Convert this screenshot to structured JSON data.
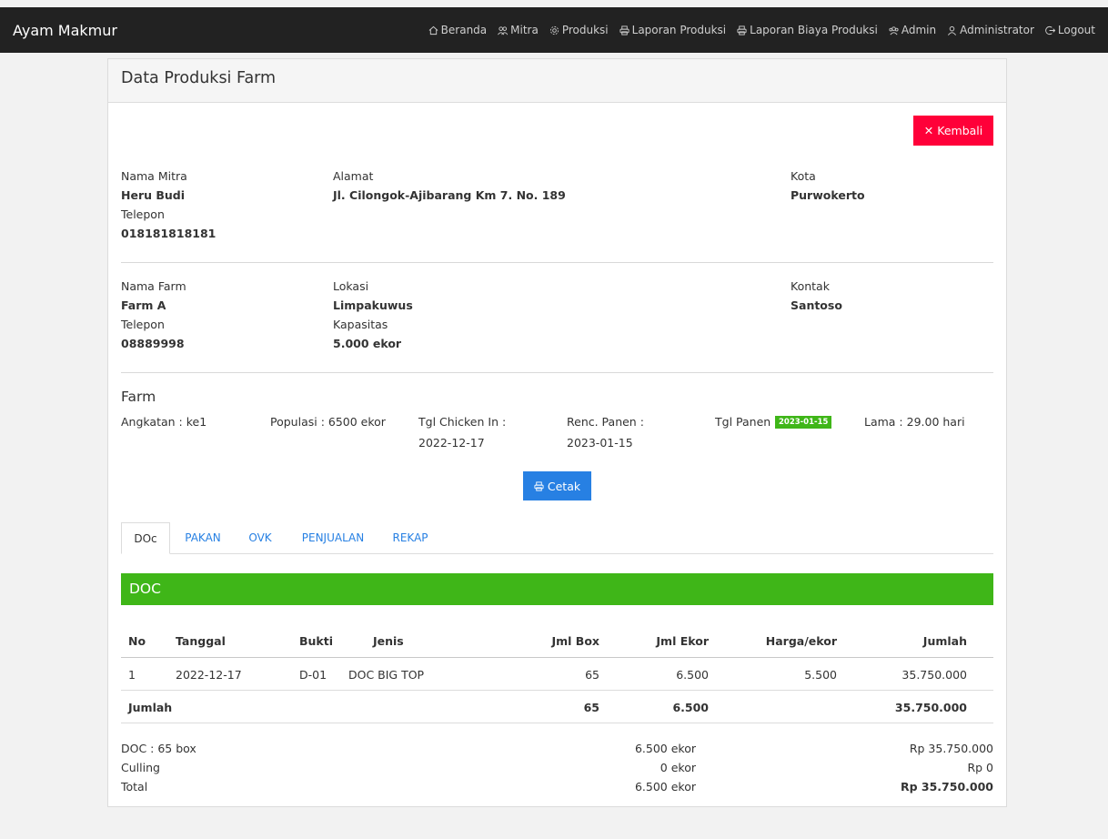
{
  "navbar": {
    "brand": "Ayam Makmur",
    "items": [
      {
        "label": "Beranda",
        "icon": "home-icon"
      },
      {
        "label": "Mitra",
        "icon": "users-icon"
      },
      {
        "label": "Produksi",
        "icon": "gear-icon"
      },
      {
        "label": "Laporan Produksi",
        "icon": "printer-icon"
      },
      {
        "label": "Laporan Biaya Produksi",
        "icon": "printer-icon"
      },
      {
        "label": "Admin",
        "icon": "group-icon"
      },
      {
        "label": "Administrator",
        "icon": "user-icon"
      },
      {
        "label": "Logout",
        "icon": "logout-icon"
      }
    ]
  },
  "panel": {
    "title": "Data Produksi Farm",
    "back_label": "Kembali",
    "print_label": "Cetak"
  },
  "mitra": {
    "nama_label": "Nama Mitra",
    "nama": "Heru Budi",
    "telepon_label": "Telepon",
    "telepon": "018181818181",
    "alamat_label": "Alamat",
    "alamat": "Jl. Cilongok-Ajibarang Km 7. No. 189",
    "kota_label": "Kota",
    "kota": "Purwokerto"
  },
  "farm_info": {
    "nama_label": "Nama Farm",
    "nama": "Farm A",
    "telepon_label": "Telepon",
    "telepon": "08889998",
    "lokasi_label": "Lokasi",
    "lokasi": "Limpakuwus",
    "kapasitas_label": "Kapasitas",
    "kapasitas": "5.000 ekor",
    "kontak_label": "Kontak",
    "kontak": "Santoso"
  },
  "farm": {
    "title": "Farm",
    "angkatan": "Angkatan : ke1",
    "populasi": "Populasi : 6500 ekor",
    "chicken_in_label": "Tgl Chicken In :",
    "chicken_in": "2022-12-17",
    "renc_panen_label": "Renc. Panen :",
    "renc_panen": "2023-01-15",
    "tgl_panen_label": "Tgl Panen :",
    "tgl_panen": "2023-01-15",
    "lama": "Lama : 29.00 hari"
  },
  "tabs": [
    "DOc",
    "PAKAN",
    "OVK",
    "PENJUALAN",
    "REKAP"
  ],
  "doc": {
    "heading": "DOC",
    "headers": {
      "no": "No",
      "tanggal": "Tanggal",
      "bukti": "Bukti",
      "jenis": "Jenis",
      "jml_box": "Jml Box",
      "jml_ekor": "Jml Ekor",
      "harga": "Harga/ekor",
      "jumlah": "Jumlah"
    },
    "rows": [
      {
        "no": "1",
        "tanggal": "2022-12-17",
        "bukti": "D-01",
        "jenis": "DOC BIG TOP",
        "jml_box": "65",
        "jml_ekor": "6.500",
        "harga": "5.500",
        "jumlah": "35.750.000"
      }
    ],
    "total": {
      "label": "Jumlah",
      "jml_box": "65",
      "jml_ekor": "6.500",
      "jumlah": "35.750.000"
    }
  },
  "summary": [
    {
      "label": "DOC : 65 box",
      "ekor": "6.500 ekor",
      "rp": "Rp 35.750.000"
    },
    {
      "label": "Culling",
      "ekor": "0 ekor",
      "rp": "Rp 0"
    },
    {
      "label": "Total",
      "ekor": "6.500 ekor",
      "rp": "Rp 35.750.000"
    }
  ],
  "colors": {
    "navbar": "#222222",
    "danger": "#ff0039",
    "primary": "#2780e3",
    "success": "#3fb618"
  }
}
